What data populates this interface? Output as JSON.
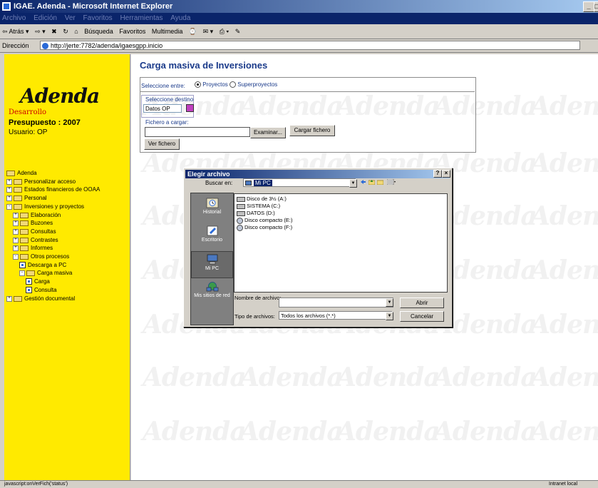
{
  "window": {
    "title": "IGAE. Adenda - Microsoft Internet Explorer",
    "controls": [
      "_",
      "□"
    ]
  },
  "menu": [
    "Archivo",
    "Edición",
    "Ver",
    "Favoritos",
    "Herramientas",
    "Ayuda"
  ],
  "toolbar": [
    "⇦ Atrás ▾",
    "⇨ ▾",
    "✖",
    "↻",
    "⌂",
    "Búsqueda",
    "Favoritos",
    "Multimedia",
    "⌚",
    "✉ ▾",
    "⎙ ▾",
    "✎"
  ],
  "address": {
    "label": "Dirección",
    "url": "http://jerte:7782/adenda/igaesgpp.inicio"
  },
  "left": {
    "logo": "Adenda",
    "environment": "Desarrollo",
    "budget": "Presupuesto : 2007",
    "user": "Usuario: OP",
    "tree": [
      {
        "label": "Adenda",
        "indent": 0,
        "type": "folder",
        "toggle": ""
      },
      {
        "label": "Personalizar acceso",
        "indent": 0,
        "type": "folder",
        "toggle": "+"
      },
      {
        "label": "Estados financieros de OOAA",
        "indent": 0,
        "type": "folder",
        "toggle": "+"
      },
      {
        "label": "Personal",
        "indent": 0,
        "type": "folder",
        "toggle": "+"
      },
      {
        "label": "Inversiones y proyectos",
        "indent": 0,
        "type": "folder",
        "toggle": "-"
      },
      {
        "label": "Elaboración",
        "indent": 1,
        "type": "folder",
        "toggle": "+"
      },
      {
        "label": "Buzones",
        "indent": 1,
        "type": "folder",
        "toggle": "+"
      },
      {
        "label": "Consultas",
        "indent": 1,
        "type": "folder",
        "toggle": "+"
      },
      {
        "label": "Contrastes",
        "indent": 1,
        "type": "folder",
        "toggle": "+"
      },
      {
        "label": "Informes",
        "indent": 1,
        "type": "folder",
        "toggle": "+"
      },
      {
        "label": "Otros procesos",
        "indent": 1,
        "type": "folder",
        "toggle": "-"
      },
      {
        "label": "Descarga a PC",
        "indent": 2,
        "type": "doc",
        "toggle": ""
      },
      {
        "label": "Carga masiva",
        "indent": 2,
        "type": "folder",
        "toggle": "-"
      },
      {
        "label": "Carga",
        "indent": 3,
        "type": "doc",
        "toggle": ""
      },
      {
        "label": "Consulta",
        "indent": 3,
        "type": "doc",
        "toggle": ""
      },
      {
        "label": "Gestión documental",
        "indent": 0,
        "type": "folder",
        "toggle": "+"
      }
    ]
  },
  "form": {
    "title": "Carga masiva de Inversiones",
    "choose_label": "Seleccione entre:",
    "radio_projects": "Proyectos",
    "radio_superprojects": "Superproyectos",
    "dest_label": "Seleccione destino",
    "dest_value": "Datos OP",
    "file_label": "Fichero a cargar:",
    "file_value": "",
    "browse_button": "Examinar...",
    "upload_button": "Cargar fichero",
    "view_button": "Ver fichero",
    "watermark": "Adenda"
  },
  "dialog": {
    "title": "Elegir archivo",
    "title_controls": [
      "?",
      "×"
    ],
    "look_in_label": "Buscar en:",
    "look_in_value": "Mi PC",
    "places": [
      "Historial",
      "Escritorio",
      "Mi PC",
      "Mis sitios de red"
    ],
    "files": [
      {
        "name": "Disco de 3½ (A:)",
        "kind": "floppy"
      },
      {
        "name": "SISTEMA (C:)",
        "kind": "disk"
      },
      {
        "name": "DATOS (D:)",
        "kind": "disk"
      },
      {
        "name": "Disco compacto (E:)",
        "kind": "cd"
      },
      {
        "name": "Disco compacto (F:)",
        "kind": "cd"
      }
    ],
    "filename_label": "Nombre de archivo:",
    "filename_value": "",
    "filetype_label": "Tipo de archivos:",
    "filetype_value": "Todos los archivos (*.*)",
    "open_button": "Abrir",
    "cancel_button": "Cancelar"
  },
  "status": {
    "text": "javascript:onVerFich('status')",
    "zone": "Intranet local"
  }
}
